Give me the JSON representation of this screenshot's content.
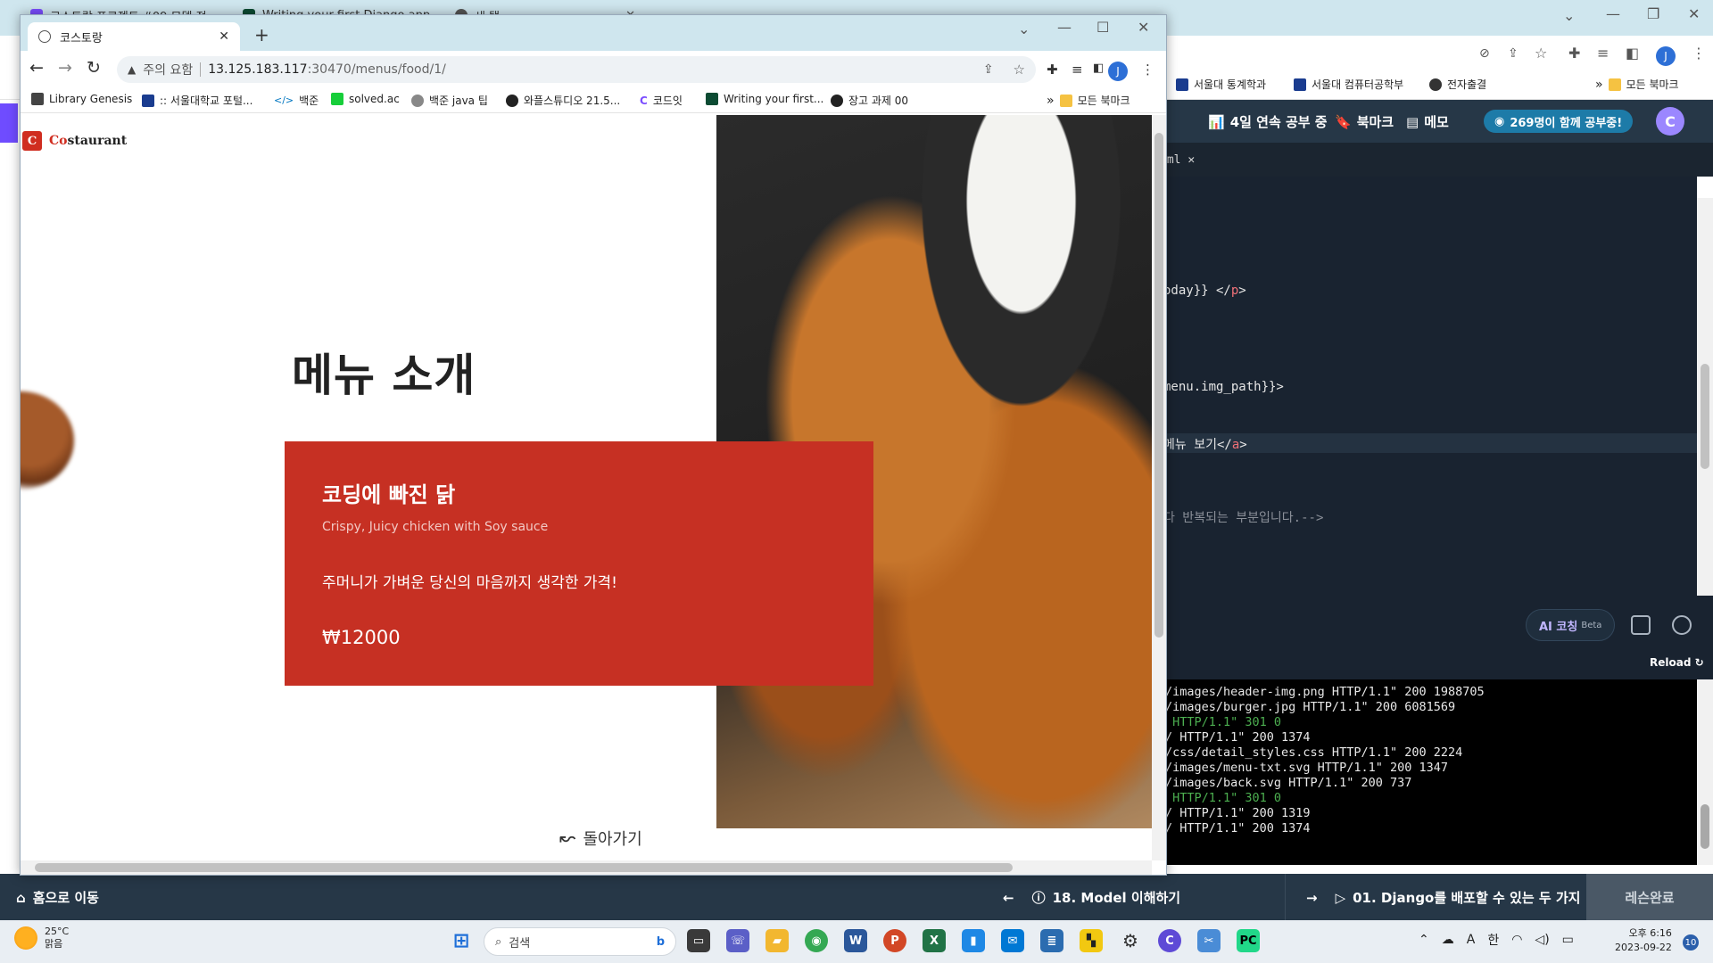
{
  "bg_browser": {
    "tabs": [
      {
        "label": "코스토랑 프로젝트 #09 모델 정...",
        "fav_color": "#7b4dff"
      },
      {
        "label": "Writing your first Django app, ...",
        "fav_color": "#0c4b33"
      },
      {
        "label": "새 탭",
        "fav_color": "#555555"
      }
    ],
    "bookmarks": [
      "서울대 통계학과",
      "서울대 컴퓨터공학부",
      "전자출결"
    ],
    "all_bookmarks": "모든 북마크"
  },
  "ide": {
    "streak": "4일 연속 공부 중",
    "bookmark": "북마크",
    "memo": "메모",
    "studying_now": "269명이 함께 공부중!",
    "avatar_letter": "C",
    "file_tab": "tml",
    "code_lines": [
      {
        "pre": "oday}} </",
        "tag": "p",
        "post": ">"
      },
      {
        "pre": "menu.img_path}}>",
        "tag": "",
        "post": ""
      },
      {
        "pre": "메뉴 보기</",
        "tag": "a",
        "post": ">"
      },
      {
        "pre": "다 반복되는 부분입니다.-->",
        "tag": "",
        "post": ""
      }
    ],
    "ai_coaching": "AI 코칭",
    "beta": "Beta",
    "reload": "Reload",
    "terminal_lines": [
      {
        "text": "/images/header-img.png HTTP/1.1\" 200 1988705",
        "green": false
      },
      {
        "text": "/images/burger.jpg HTTP/1.1\" 200 6081569",
        "green": false
      },
      {
        "text": " HTTP/1.1\" 301 0",
        "green": true
      },
      {
        "text": "/ HTTP/1.1\" 200 1374",
        "green": false
      },
      {
        "text": "/css/detail_styles.css HTTP/1.1\" 200 2224",
        "green": false
      },
      {
        "text": "/images/menu-txt.svg HTTP/1.1\" 200 1347",
        "green": false
      },
      {
        "text": "/images/back.svg HTTP/1.1\" 200 737",
        "green": false
      },
      {
        "text": " HTTP/1.1\" 301 0",
        "green": true
      },
      {
        "text": "/ HTTP/1.1\" 200 1319",
        "green": false
      },
      {
        "text": "/ HTTP/1.1\" 200 1374",
        "green": false
      }
    ]
  },
  "lesson_bar": {
    "home": "홈으로 이동",
    "prev": "18. Model 이해하기",
    "next": "01. Django를 배포할 수 있는 두 가지 ...",
    "complete": "레슨완료"
  },
  "fg_browser": {
    "tab_title": "코스토랑",
    "omnibox": {
      "warning": "주의 요함",
      "host": "13.125.183.117",
      "path": ":30470/menus/food/1/"
    },
    "profile_letter": "J",
    "bookmarks": [
      {
        "label": "Library Genesis",
        "color": "#444444"
      },
      {
        "label": ":: 서울대학교 포털...",
        "color": "#1a3c8f"
      },
      {
        "label": "백준",
        "color": "#0076c0"
      },
      {
        "label": "solved.ac",
        "color": "#17ce3a"
      },
      {
        "label": "백준 java 팁",
        "color": "#888888"
      },
      {
        "label": "와플스튜디오 21.5...",
        "color": "#222222"
      },
      {
        "label": "코드잇",
        "color": "#7b4dff"
      },
      {
        "label": "Writing your first...",
        "color": "#0c4b33"
      },
      {
        "label": "장고 과제 00",
        "color": "#222222"
      }
    ],
    "all_bookmarks": "모든 북마크"
  },
  "page": {
    "logo_mark": "C",
    "logo_first": "Co",
    "logo_rest": "staurant",
    "title": "메뉴 소개",
    "menu": {
      "name": "코딩에 빠진 닭",
      "name_en": "Crispy, Juicy chicken with Soy sauce",
      "description": "주머니가 가벼운 당신의 마음까지 생각한 가격!",
      "price": "₩12000"
    },
    "back": "돌아가기"
  },
  "taskbar": {
    "temperature": "25°C",
    "weather": "맑음",
    "search_placeholder": "검색",
    "ime": "한",
    "time": "오후 6:16",
    "date": "2023-09-22",
    "notifications": "10"
  },
  "colors": {
    "accent_red": "#c63023",
    "ide_dark": "#263747",
    "badge_blue": "#1d7ba8"
  }
}
